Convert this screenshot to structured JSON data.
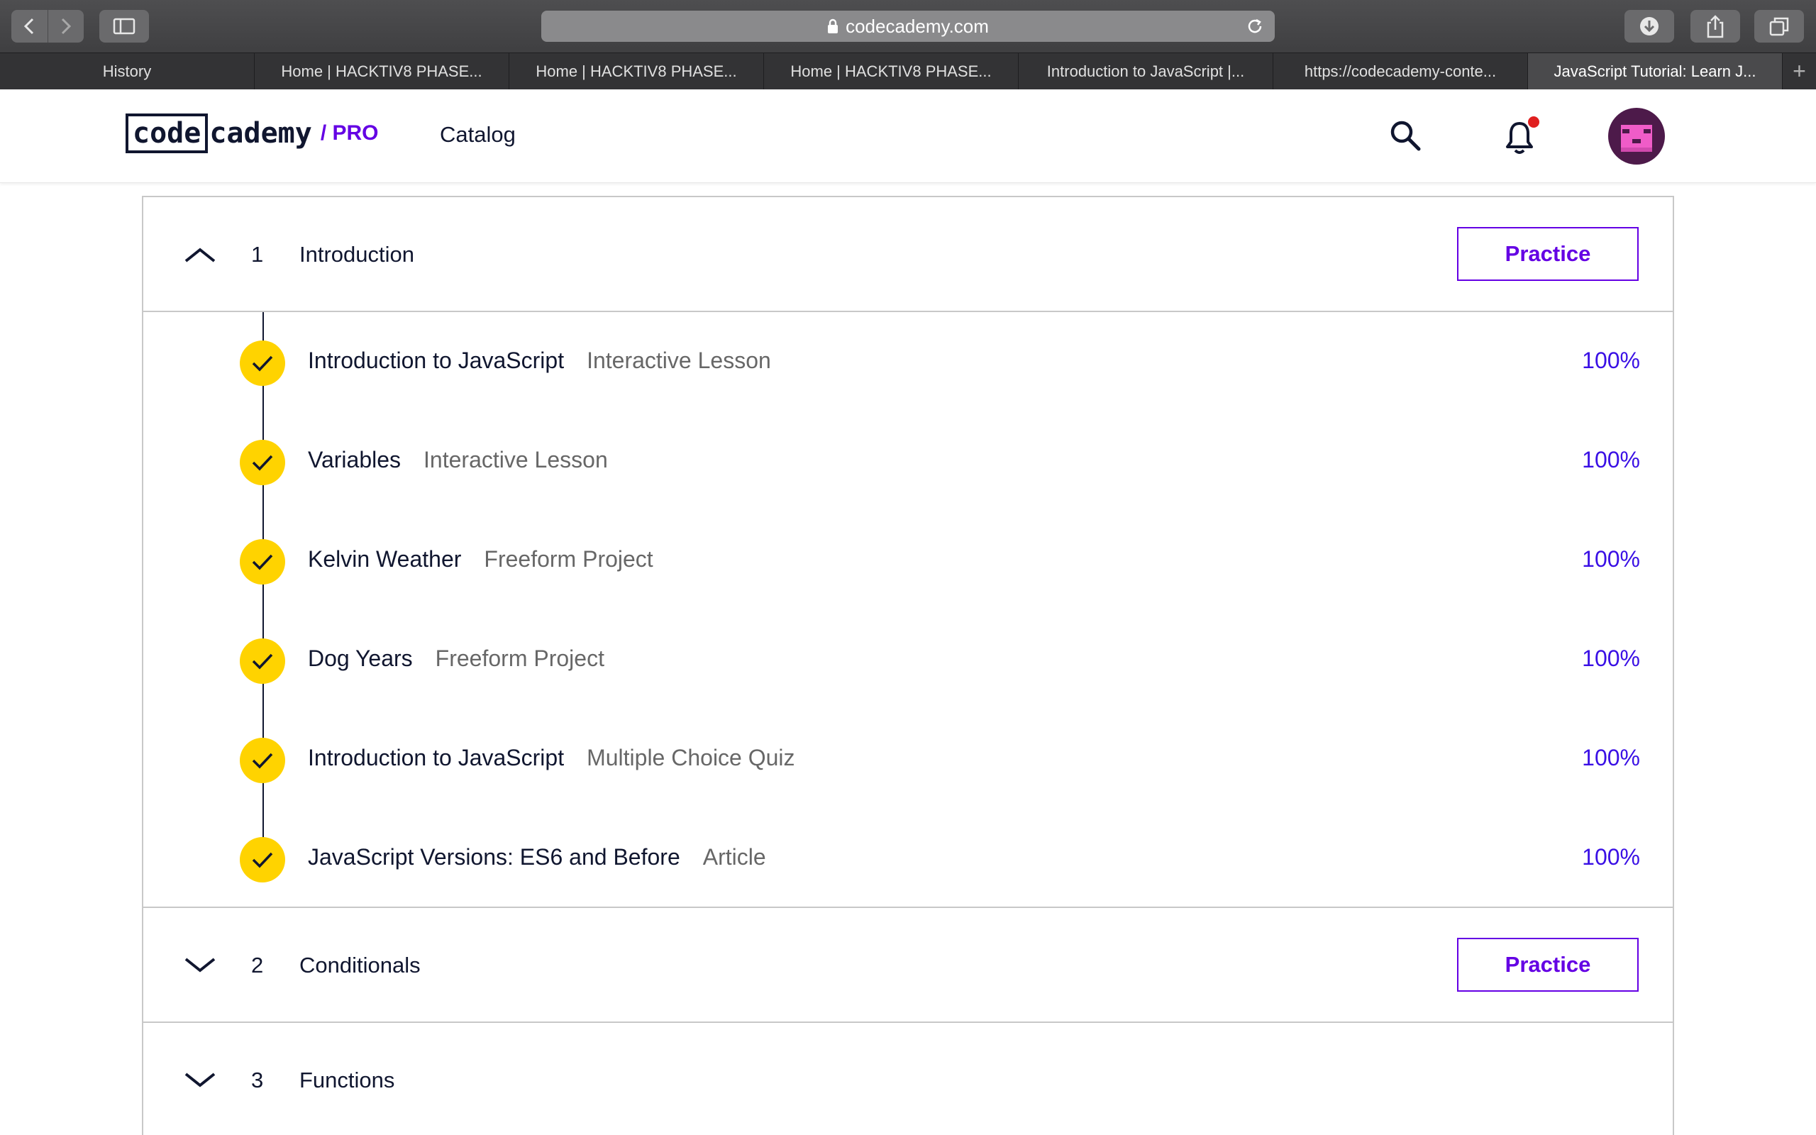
{
  "browser": {
    "url": "codecademy.com",
    "tabs": [
      {
        "label": "History",
        "active": false
      },
      {
        "label": "Home | HACKTIV8 PHASE...",
        "active": false
      },
      {
        "label": "Home | HACKTIV8 PHASE...",
        "active": false
      },
      {
        "label": "Home | HACKTIV8 PHASE...",
        "active": false
      },
      {
        "label": "Introduction to JavaScript |...",
        "active": false
      },
      {
        "label": "https://codecademy-conte...",
        "active": false
      },
      {
        "label": "JavaScript Tutorial: Learn J...",
        "active": true
      }
    ],
    "new_tab_label": "+"
  },
  "header": {
    "logo_code": "code",
    "logo_rest": "cademy",
    "logo_pro": "/ PRO",
    "catalog_label": "Catalog",
    "has_notification": true
  },
  "syllabus": {
    "modules": [
      {
        "number": "1",
        "title": "Introduction",
        "expanded": true,
        "practice_label": "Practice",
        "lessons": [
          {
            "title": "Introduction to JavaScript",
            "type": "Interactive Lesson",
            "progress": "100%",
            "completed": true
          },
          {
            "title": "Variables",
            "type": "Interactive Lesson",
            "progress": "100%",
            "completed": true
          },
          {
            "title": "Kelvin Weather",
            "type": "Freeform Project",
            "progress": "100%",
            "completed": true
          },
          {
            "title": "Dog Years",
            "type": "Freeform Project",
            "progress": "100%",
            "completed": true
          },
          {
            "title": "Introduction to JavaScript",
            "type": "Multiple Choice Quiz",
            "progress": "100%",
            "completed": true
          },
          {
            "title": "JavaScript Versions: ES6 and Before",
            "type": "Article",
            "progress": "100%",
            "completed": true
          }
        ]
      },
      {
        "number": "2",
        "title": "Conditionals",
        "expanded": false,
        "practice_label": "Practice"
      },
      {
        "number": "3",
        "title": "Functions",
        "expanded": false
      }
    ]
  },
  "colors": {
    "accent": "#6400e4",
    "progress": "#3a10e5",
    "check": "#ffd300",
    "notification": "#e01f1f"
  }
}
